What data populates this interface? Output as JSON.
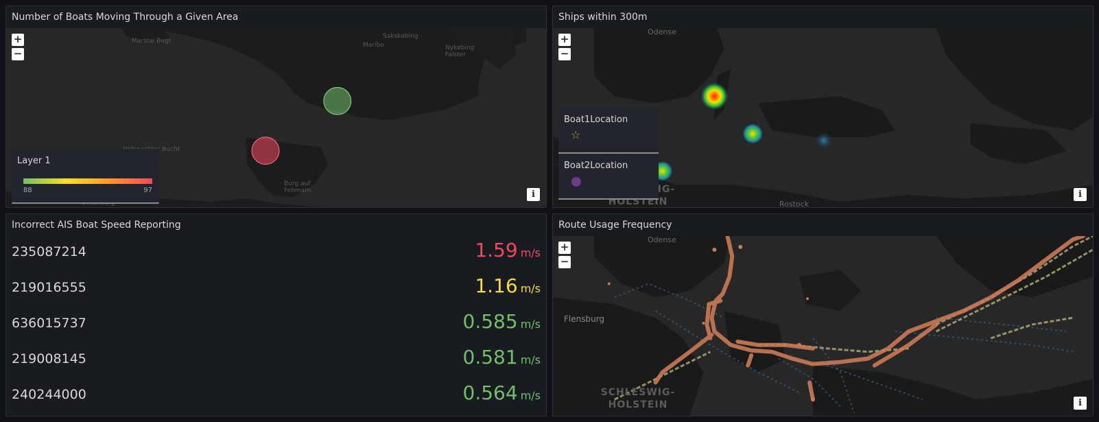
{
  "panels": {
    "boats_area": {
      "title": "Number of Boats Moving Through a Given Area",
      "map_labels": [
        "Marstal Bugt",
        "Sakskøbing",
        "Maribo",
        "Nykøbing Falster",
        "Burg auf Fehmarn",
        "Schönberg",
        "Hohwachter Bucht"
      ],
      "legend": {
        "title": "Layer 1",
        "min": "88",
        "max": "97"
      },
      "zoom_in": "+",
      "zoom_out": "−",
      "info": "i"
    },
    "ships_300m": {
      "title": "Ships within 300m",
      "map_labels": [
        "Odense",
        "SCHLESWIG-HOLSTEIN",
        "Rostock"
      ],
      "legend": {
        "items": [
          {
            "label": "Boat1Location",
            "icon": "star-icon",
            "color": "#b8a331"
          },
          {
            "label": "Boat2Location",
            "icon": "circle-icon",
            "color": "#6f3a88"
          }
        ]
      },
      "zoom_in": "+",
      "zoom_out": "−",
      "info": "i"
    },
    "ais_speed": {
      "title": "Incorrect AIS Boat Speed Reporting",
      "unit": "m/s",
      "rows": [
        {
          "name": "235087214",
          "value": "1.59",
          "color": "#f2495c"
        },
        {
          "name": "219016555",
          "value": "1.16",
          "color": "#fade2a"
        },
        {
          "name": "636015737",
          "value": "0.585",
          "color": "#73bf69"
        },
        {
          "name": "219008145",
          "value": "0.581",
          "color": "#73bf69"
        },
        {
          "name": "240244000",
          "value": "0.564",
          "color": "#73bf69"
        }
      ]
    },
    "route_usage": {
      "title": "Route Usage Frequency",
      "map_labels": [
        "Odense",
        "Flensburg",
        "SCHLESWIG-HOLSTEIN"
      ],
      "zoom_in": "+",
      "zoom_out": "−",
      "info": "i"
    }
  },
  "colors": {
    "red": "#f2495c",
    "yellow": "#fade2a",
    "green": "#73bf69",
    "panel_bg": "#181b1f",
    "map_bg": "#262626",
    "land": "#111111"
  }
}
